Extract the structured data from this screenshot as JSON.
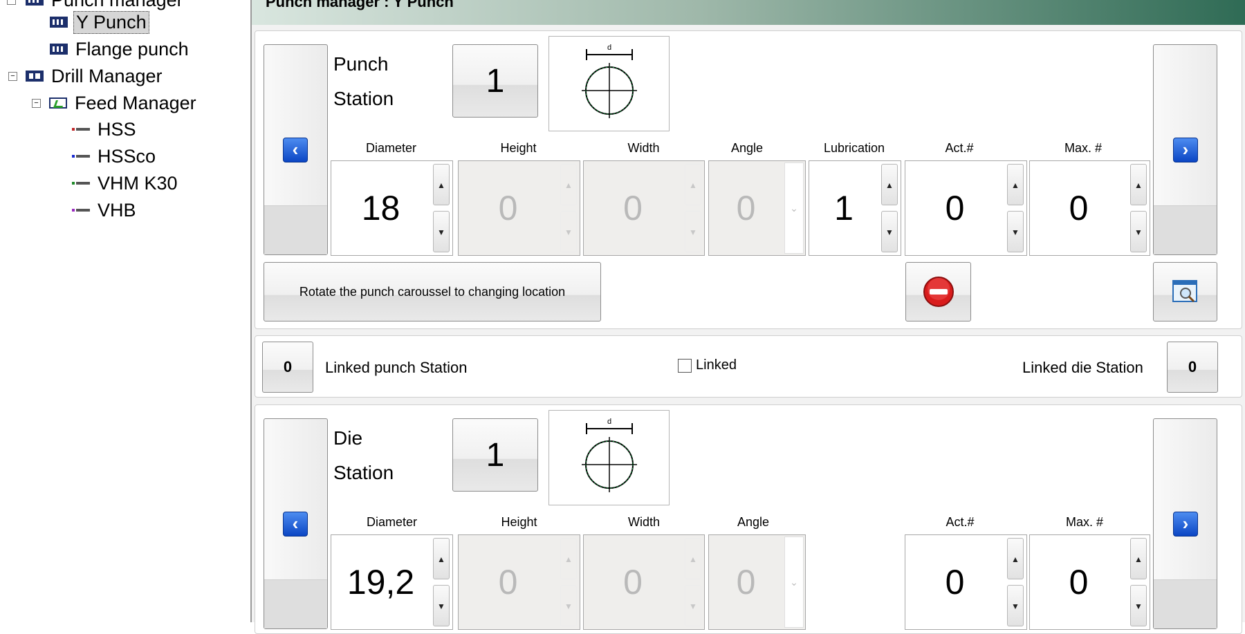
{
  "tree": {
    "items": [
      {
        "label": "Punch manager",
        "icon": "punch-icon"
      },
      {
        "label": "Y Punch",
        "icon": "punch-icon",
        "selected": true
      },
      {
        "label": "Flange punch",
        "icon": "punch-icon"
      },
      {
        "label": "Drill Manager",
        "icon": "drill-icon"
      },
      {
        "label": "Feed Manager",
        "icon": "feed-icon"
      },
      {
        "label": "HSS",
        "icon": "tool-icon",
        "color": "#c0282a"
      },
      {
        "label": "HSSco",
        "icon": "tool-icon",
        "color": "#1a2bd0"
      },
      {
        "label": "VHM K30",
        "icon": "tool-icon",
        "color": "#1f8a2a"
      },
      {
        "label": "VHB",
        "icon": "tool-icon",
        "color": "#9a2bbf"
      }
    ]
  },
  "header": {
    "title": "Punch manager : Y Punch"
  },
  "punch": {
    "station_label_1": "Punch",
    "station_label_2": "Station",
    "station_number": "1",
    "columns": {
      "diameter": "Diameter",
      "height": "Height",
      "width": "Width",
      "angle": "Angle",
      "lubrication": "Lubrication",
      "act": "Act.#",
      "max": "Max. #"
    },
    "values": {
      "diameter": "18",
      "height": "0",
      "width": "0",
      "angle": "0",
      "lubrication": "1",
      "act": "0",
      "max": "0"
    },
    "rotate_label": "Rotate the punch caroussel to changing location"
  },
  "link": {
    "punch_station_value": "0",
    "punch_station_label": "Linked punch Station",
    "linked_label": "Linked",
    "die_station_label": "Linked die Station",
    "die_station_value": "0"
  },
  "die": {
    "station_label_1": "Die",
    "station_label_2": "Station",
    "station_number": "1",
    "columns": {
      "diameter": "Diameter",
      "height": "Height",
      "width": "Width",
      "angle": "Angle",
      "act": "Act.#",
      "max": "Max. #"
    },
    "values": {
      "diameter": "19,2",
      "height": "0",
      "width": "0",
      "angle": "0",
      "act": "0",
      "max": "0"
    }
  },
  "diagram": {
    "dimension_label": "d"
  },
  "colors": {
    "accent": "#0b46c4",
    "stop": "#d91c1c"
  }
}
